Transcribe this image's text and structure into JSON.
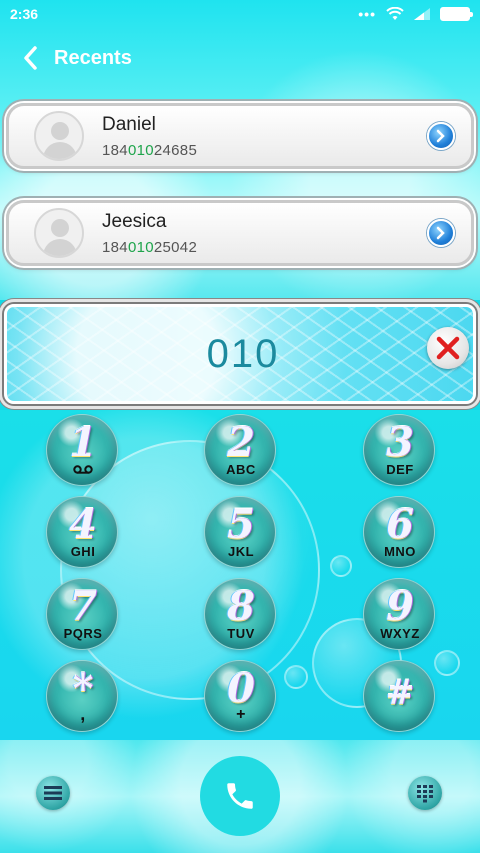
{
  "status_bar": {
    "time": "2:36",
    "icons": [
      "more-dots-icon",
      "wifi-icon",
      "signal-icon",
      "battery-icon"
    ]
  },
  "header": {
    "back_icon": "chevron-left-icon",
    "title": "Recents"
  },
  "recents": [
    {
      "name": "Daniel",
      "number_prefix": "184",
      "number_match": "010",
      "number_suffix": "24685"
    },
    {
      "name": "Jeesica",
      "number_prefix": "184",
      "number_match": "010",
      "number_suffix": "25042"
    }
  ],
  "dial": {
    "input": "010",
    "clear_icon": "close-x-icon"
  },
  "keypad": {
    "keys": [
      {
        "digit": "1",
        "letters": ""
      },
      {
        "digit": "2",
        "letters": "ABC"
      },
      {
        "digit": "3",
        "letters": "DEF"
      },
      {
        "digit": "4",
        "letters": "GHI"
      },
      {
        "digit": "5",
        "letters": "JKL"
      },
      {
        "digit": "6",
        "letters": "MNO"
      },
      {
        "digit": "7",
        "letters": "PQRS"
      },
      {
        "digit": "8",
        "letters": "TUV"
      },
      {
        "digit": "9",
        "letters": "WXYZ"
      },
      {
        "digit": "*",
        "letters": ","
      },
      {
        "digit": "0",
        "letters": "+"
      },
      {
        "digit": "#",
        "letters": ""
      }
    ]
  },
  "bottom_bar": {
    "left_icon": "menu-icon",
    "call_icon": "phone-icon",
    "right_icon": "dialpad-grid-icon"
  },
  "colors": {
    "accent": "#22dbe2",
    "match_highlight": "#1ea44b",
    "dial_text": "#1b8a9e",
    "clear_x": "#e02020"
  }
}
